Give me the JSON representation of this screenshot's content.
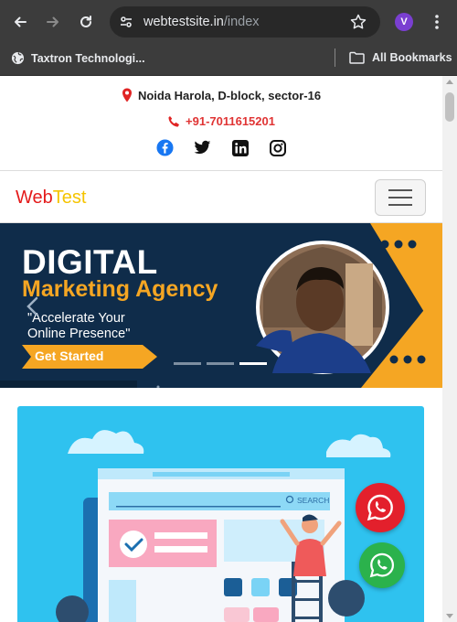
{
  "browser": {
    "url_host": "webtestsite.in",
    "url_path": "/index",
    "profile_initial": "V",
    "bookmarks": [
      {
        "label": "Taxtron Technologi..."
      },
      {
        "label": "All Bookmarks"
      }
    ]
  },
  "site": {
    "address": "Noida Harola, D-block, sector-16",
    "phone": "+91-7011615201",
    "brand_part1": "Web",
    "brand_part2": "Test"
  },
  "hero": {
    "headline": "DIGITAL",
    "subheadline": "Marketing Agency",
    "quote_line1": "\"Accelerate Your",
    "quote_line2": "Online Presence\"",
    "cta_label": "Get Started",
    "slide_count": 3,
    "active_slide": 3
  },
  "illustration": {
    "search_label": "SEARCH"
  },
  "colors": {
    "brand_red": "#e41b1b",
    "brand_yellow": "#f5c400",
    "hero_navy": "#0f2c4a",
    "hero_orange": "#f5a623",
    "card_blue": "#2fc2ef",
    "whatsapp_green": "#2bb24c",
    "whatsapp_red": "#e3202c"
  }
}
